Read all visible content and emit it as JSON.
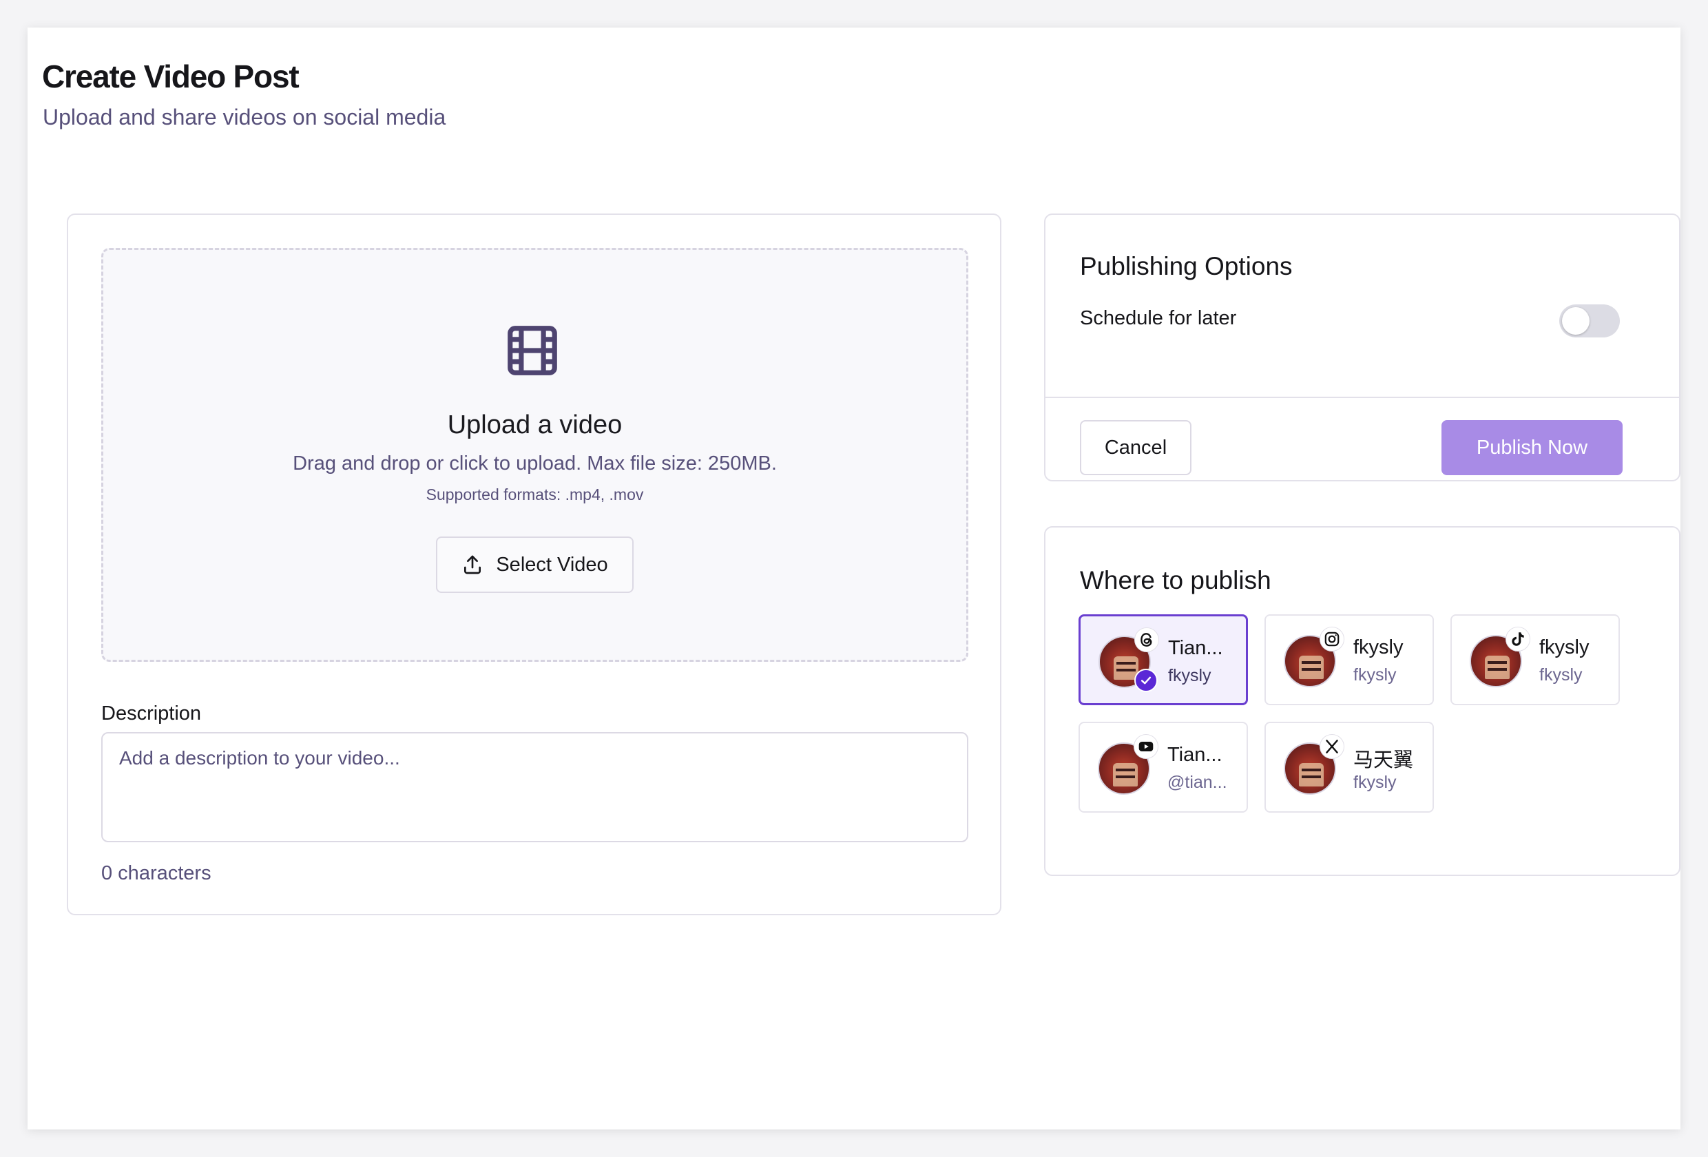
{
  "header": {
    "title": "Create Video Post",
    "subtitle": "Upload and share videos on social media"
  },
  "upload": {
    "icon": "film-icon",
    "title": "Upload a video",
    "description": "Drag and drop or click to upload. Max file size: 250MB.",
    "formats": "Supported formats: .mp4, .mov",
    "button_label": "Select Video",
    "button_icon": "upload-icon"
  },
  "description": {
    "label": "Description",
    "placeholder": "Add a description to your video...",
    "value": "",
    "char_count": "0 characters"
  },
  "publishing_options": {
    "title": "Publishing Options",
    "schedule_label": "Schedule for later",
    "schedule_enabled": false,
    "cancel_label": "Cancel",
    "publish_label": "Publish Now"
  },
  "where_to_publish": {
    "title": "Where to publish",
    "accounts": [
      {
        "name": "Tian...",
        "username": "fkysly",
        "platform": "threads-icon",
        "selected": true
      },
      {
        "name": "fkysly",
        "username": "fkysly",
        "platform": "instagram-icon",
        "selected": false
      },
      {
        "name": "fkysly",
        "username": "fkysly",
        "platform": "tiktok-icon",
        "selected": false
      },
      {
        "name": "Tian...",
        "username": "@tian...",
        "platform": "youtube-icon",
        "selected": false
      },
      {
        "name": "马天翼",
        "username": "fkysly",
        "platform": "x-icon",
        "selected": false
      }
    ]
  },
  "colors": {
    "accent": "#a88be6",
    "selected_border": "#6a3fd0",
    "check_badge": "#5b28d6",
    "muted_text": "#57507a",
    "icon_color": "#4e4470"
  }
}
